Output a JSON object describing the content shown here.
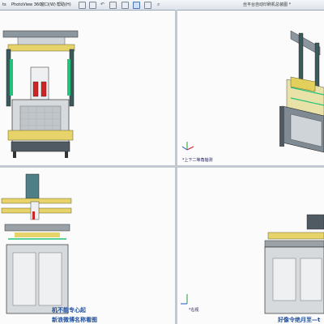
{
  "menubar": {
    "items": [
      {
        "label": "ts"
      },
      {
        "label": "PhotoView 360"
      },
      {
        "label": "窗口(W)"
      },
      {
        "label": "帮助(H)"
      }
    ],
    "document_title": "丝平台自动印刷机总装图 *"
  },
  "viewports": [
    {
      "id": "front",
      "label": ""
    },
    {
      "id": "isometric",
      "label": "*上下二等角轴测"
    },
    {
      "id": "side",
      "label": ""
    },
    {
      "id": "right",
      "label": "*右视"
    }
  ],
  "watermarks": [
    {
      "text": "机不能专心起"
    },
    {
      "text": "新浪微博名称看图"
    },
    {
      "text": "好像令绝月至—t"
    }
  ],
  "icons": [
    "save-icon",
    "print-icon",
    "undo-icon",
    "select-icon",
    "rebuild-icon",
    "options-icon",
    "view-icon",
    "zoom-icon"
  ],
  "colors": {
    "frame_gray": "#7f8a93",
    "rail_yellow": "#e2cf5c",
    "accent_green": "#22c27a",
    "axis_red": "#d02424",
    "axis_blue": "#2456c8"
  }
}
